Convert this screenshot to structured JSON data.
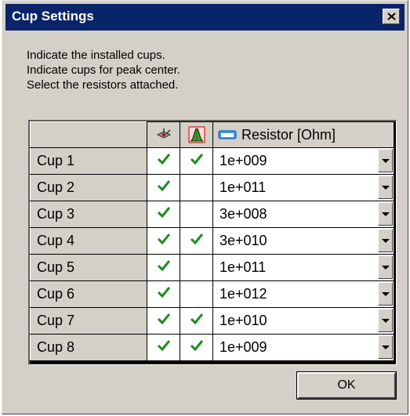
{
  "window": {
    "title": "Cup Settings"
  },
  "instructions": [
    "Indicate the installed cups.",
    "Indicate cups for peak center.",
    "Select the resistors attached."
  ],
  "table": {
    "columns": {
      "installed_icon": "detector-icon",
      "peak_center_icon": "peak-icon",
      "resistor_icon": "resistor-icon",
      "resistor_label": "Resistor [Ohm]"
    },
    "rows": [
      {
        "label": "Cup 1",
        "installed": true,
        "peak_center": true,
        "resistor": "1e+009"
      },
      {
        "label": "Cup 2",
        "installed": true,
        "peak_center": false,
        "resistor": "1e+011"
      },
      {
        "label": "Cup 3",
        "installed": true,
        "peak_center": false,
        "resistor": "3e+008"
      },
      {
        "label": "Cup 4",
        "installed": true,
        "peak_center": true,
        "resistor": "3e+010"
      },
      {
        "label": "Cup 5",
        "installed": true,
        "peak_center": false,
        "resistor": "1e+011"
      },
      {
        "label": "Cup 6",
        "installed": true,
        "peak_center": false,
        "resistor": "1e+012"
      },
      {
        "label": "Cup 7",
        "installed": true,
        "peak_center": true,
        "resistor": "1e+010"
      },
      {
        "label": "Cup 8",
        "installed": true,
        "peak_center": true,
        "resistor": "1e+009"
      }
    ]
  },
  "buttons": {
    "ok": "OK"
  },
  "colors": {
    "titlebar": "#0a246a",
    "check": "#1e8c1e",
    "face": "#d4d0c8"
  }
}
